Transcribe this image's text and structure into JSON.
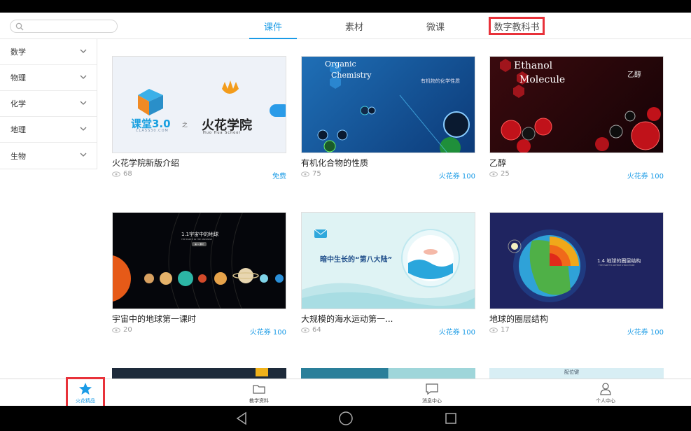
{
  "search": {
    "placeholder": ""
  },
  "tabs": [
    {
      "label": "课件",
      "active": true
    },
    {
      "label": "素材",
      "active": false
    },
    {
      "label": "微课",
      "active": false
    },
    {
      "label": "数字教科书",
      "active": false,
      "highlighted": true
    }
  ],
  "sidebar": {
    "items": [
      {
        "label": "数学"
      },
      {
        "label": "物理"
      },
      {
        "label": "化学"
      },
      {
        "label": "地理"
      },
      {
        "label": "生物"
      }
    ]
  },
  "cards": [
    {
      "title": "火花学院新版介绍",
      "views": "68",
      "price": "免费",
      "thumb": {
        "logo_left": "课堂3.0",
        "logo_left_sub": "CLASS30.COM",
        "connector": "之",
        "logo_right": "火花学院",
        "logo_right_sub": "Huo Hua School"
      }
    },
    {
      "title": "有机化合物的性质",
      "views": "75",
      "price": "火花券 100",
      "thumb": {
        "heading_1": "Organic",
        "heading_2": "Chemistry",
        "caption": "有机物的化学性质"
      }
    },
    {
      "title": "乙醇",
      "views": "25",
      "price": "火花券 100",
      "thumb": {
        "heading_1": "Ethanol",
        "heading_2": "Molecule",
        "caption": "乙醇"
      }
    },
    {
      "title": "宇宙中的地球第一课时",
      "views": "20",
      "price": "火花券 100",
      "thumb": {
        "heading": "1.1宇宙中的地球",
        "subheading": "THE EARTH IN THE UNIVERSE",
        "tag": "第 1 课时"
      }
    },
    {
      "title": "大规模的海水运动第一...",
      "views": "64",
      "price": "火花券 100",
      "thumb": {
        "heading": "暗中生长的“第八大陆”"
      }
    },
    {
      "title": "地球的圈层结构",
      "views": "17",
      "price": "火花券 100",
      "thumb": {
        "heading": "1.4 地球的圈层结构",
        "subheading": "THE EARTH'S SPHERE STRUCTURE"
      }
    }
  ],
  "partial_cards": [
    {
      "caption": ""
    },
    {
      "caption": ""
    },
    {
      "caption": "配位键"
    }
  ],
  "bottom_nav": [
    {
      "label": "火花精品",
      "icon": "star-icon",
      "active": true,
      "highlighted": true
    },
    {
      "label": "教学资料",
      "icon": "folder-icon",
      "active": false
    },
    {
      "label": "消息中心",
      "icon": "message-icon",
      "active": false
    },
    {
      "label": "个人中心",
      "icon": "person-icon",
      "active": false
    }
  ],
  "colors": {
    "accent": "#1a9be6",
    "highlight": "#e8323a"
  }
}
